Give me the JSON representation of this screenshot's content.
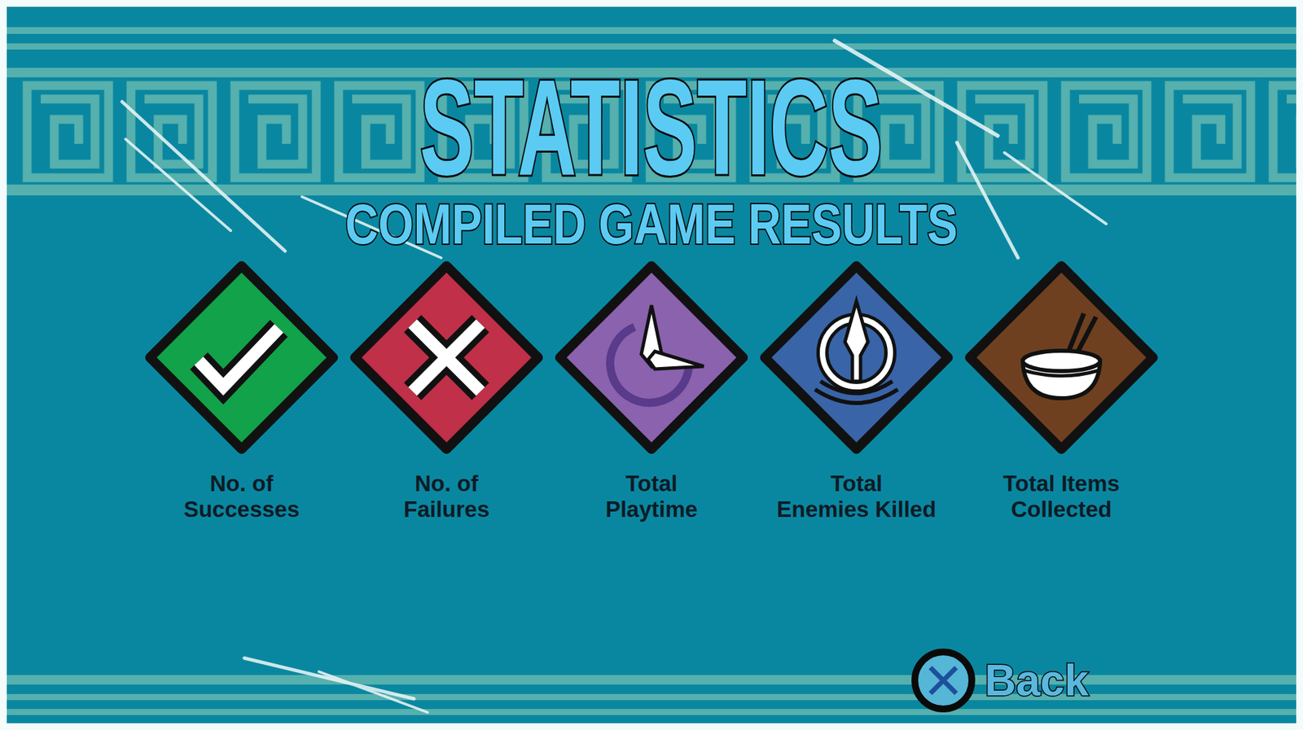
{
  "title": "STATISTICS",
  "subtitle": "COMPILED GAME RESULTS",
  "stats": [
    {
      "kind": "check",
      "label_lines": [
        "No. of",
        "Successes"
      ],
      "color": "#12a24a"
    },
    {
      "kind": "cross",
      "label_lines": [
        "No. of",
        "Failures"
      ],
      "color": "#c03048"
    },
    {
      "kind": "clock",
      "label_lines": [
        "Total",
        "Playtime"
      ],
      "color": "#8a62ae"
    },
    {
      "kind": "spear",
      "label_lines": [
        "Total",
        "Enemies Killed"
      ],
      "color": "#3a64a8"
    },
    {
      "kind": "bowl",
      "label_lines": [
        "Total Items",
        "Collected"
      ],
      "color": "#6e4020"
    }
  ],
  "back_button": {
    "label": "Back"
  }
}
